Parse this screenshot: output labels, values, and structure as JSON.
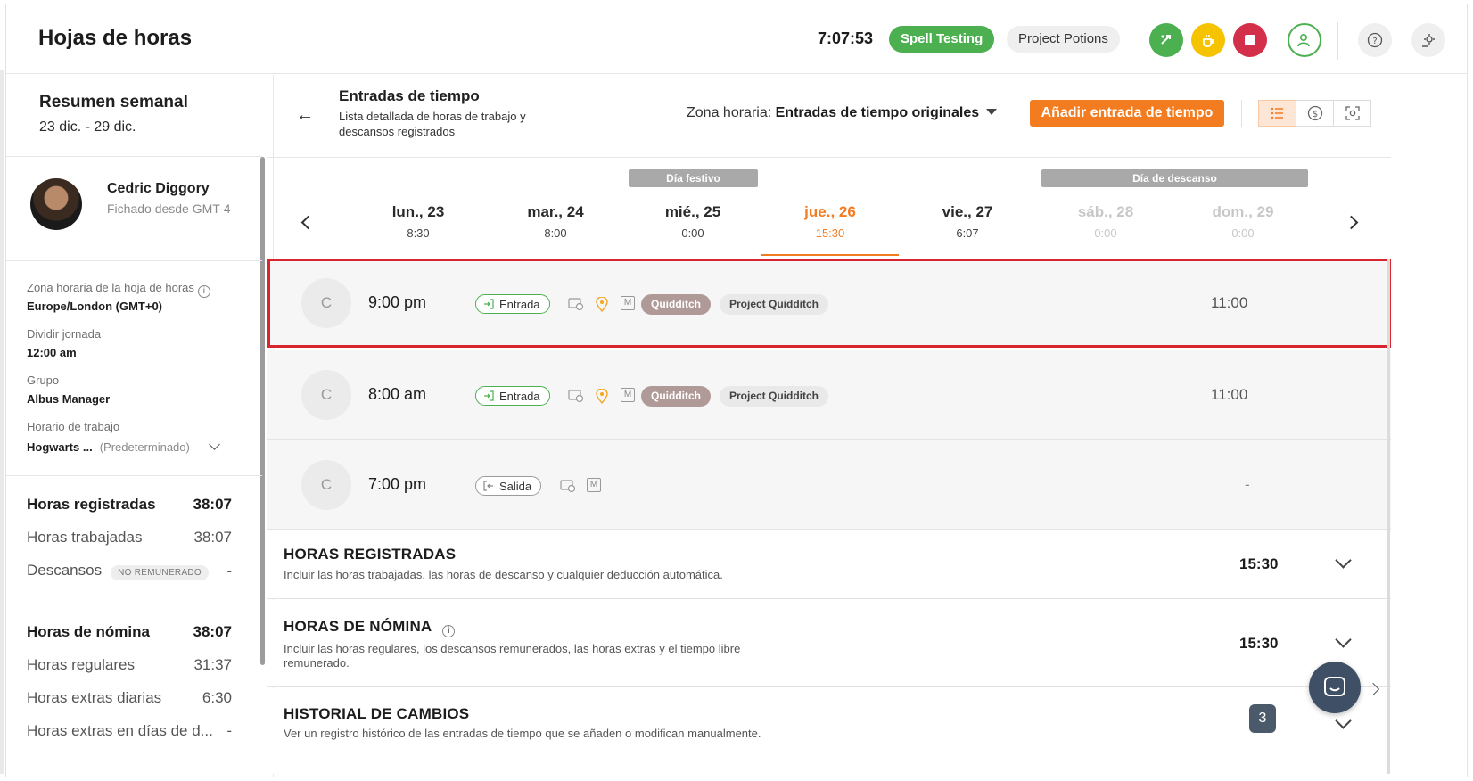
{
  "header": {
    "title": "Hojas de horas",
    "clock": "7:07:53",
    "activity": "Spell Testing",
    "project": "Project Potions",
    "colors": {
      "green": "#4caf50",
      "yellow": "#f5c300",
      "red": "#d32f4a",
      "orange": "#f47c20"
    }
  },
  "sidebar": {
    "week_title": "Resumen semanal",
    "week_range": "23 dic. - 29 dic.",
    "user": {
      "name": "Cedric Diggory",
      "sub": "Fichado desde GMT-4"
    },
    "fields": [
      {
        "label": "Zona horaria de la hoja de horas",
        "value": "Europe/London (GMT+0)"
      },
      {
        "label": "Dividir jornada",
        "value": "12:00 am"
      },
      {
        "label": "Grupo",
        "value": "Albus Manager"
      },
      {
        "label": "Horario de trabajo",
        "value": "Hogwarts ...",
        "note": "(Predeterminado)"
      }
    ],
    "stats": {
      "registered_label": "Horas registradas",
      "registered": "38:07",
      "worked_label": "Horas trabajadas",
      "worked": "38:07",
      "breaks_label": "Descansos",
      "breaks_badge": "NO REMUNERADO",
      "breaks": "-",
      "payroll_label": "Horas de nómina",
      "payroll": "38:07",
      "regular_label": "Horas regulares",
      "regular": "31:37",
      "overtime_label": "Horas extras diarias",
      "overtime": "6:30",
      "restday_label": "Horas extras en días de d...",
      "restday": "-"
    }
  },
  "main": {
    "title": "Entradas de tiempo",
    "subtitle": "Lista detallada de horas de trabajo y descansos registrados",
    "tz_label": "Zona horaria:",
    "tz_value": "Entradas de tiempo originales",
    "add_button": "Añadir entrada de tiempo",
    "holiday_tag": "Día festivo",
    "rest_tag": "Día de descanso",
    "days": [
      {
        "name": "lun., 23",
        "value": "8:30"
      },
      {
        "name": "mar., 24",
        "value": "8:00"
      },
      {
        "name": "mié., 25",
        "value": "0:00"
      },
      {
        "name": "jue., 26",
        "value": "15:30"
      },
      {
        "name": "vie., 27",
        "value": "6:07"
      },
      {
        "name": "sáb., 28",
        "value": "0:00"
      },
      {
        "name": "dom., 29",
        "value": "0:00"
      }
    ],
    "entries": [
      {
        "initial": "C",
        "time": "9:00 pm",
        "type": "Entrada",
        "m": "M",
        "activity": "Quidditch",
        "project": "Project Quidditch",
        "duration": "11:00"
      },
      {
        "initial": "C",
        "time": "8:00 am",
        "type": "Entrada",
        "m": "M",
        "activity": "Quidditch",
        "project": "Project Quidditch",
        "duration": "11:00"
      },
      {
        "initial": "C",
        "time": "7:00 pm",
        "type": "Salida",
        "m": "M",
        "duration": "-"
      }
    ],
    "sections": [
      {
        "title": "HORAS REGISTRADAS",
        "desc": "Incluir las horas trabajadas, las horas de descanso y cualquier deducción automática.",
        "value": "15:30"
      },
      {
        "title": "HORAS DE NÓMINA",
        "desc": "Incluir las horas regulares, los descansos remunerados, las horas extras y el tiempo libre remunerado.",
        "value": "15:30"
      },
      {
        "title": "HISTORIAL DE CAMBIOS",
        "desc": "Ver un registro histórico de las entradas de tiempo que se añaden o modifican manualmente."
      }
    ],
    "chat_badge": "3"
  }
}
